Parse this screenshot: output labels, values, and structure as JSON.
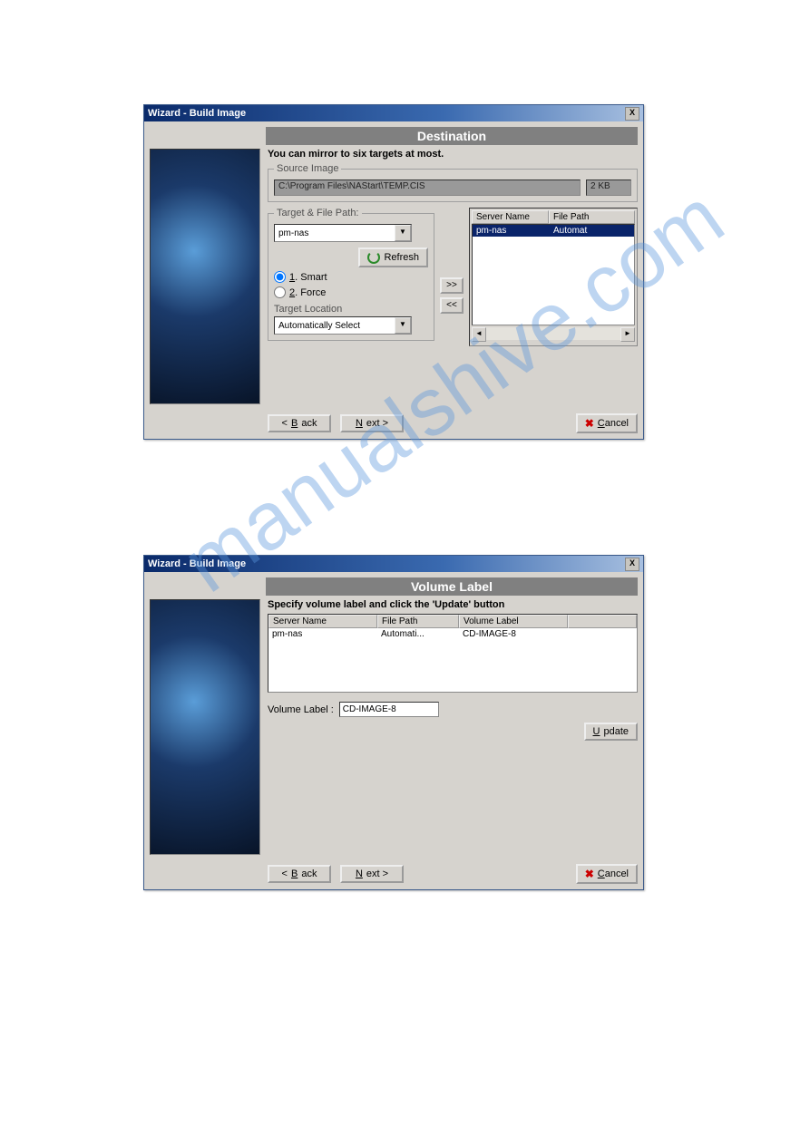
{
  "watermark": "manualshive.com",
  "window1": {
    "title": "Wizard - Build Image",
    "banner": "Destination",
    "subtitle": "You can mirror to six targets at most.",
    "source_legend": "Source Image",
    "source_path": "C:\\Program Files\\NAStart\\TEMP.CIS",
    "source_size": "2 KB",
    "target_legend": "Target & File Path:",
    "target_combo": "pm-nas",
    "refresh_btn": "Refresh",
    "radio_smart": "1. Smart",
    "radio_force": "2. Force",
    "loc_label": "Target Location",
    "loc_combo": "Automatically Select",
    "list_hdr_server": "Server Name",
    "list_hdr_path": "File Path",
    "list_row_server": "pm-nas",
    "list_row_path": "Automat",
    "btn_back": "< Back",
    "btn_next": "Next >",
    "btn_cancel": "Cancel"
  },
  "window2": {
    "title": "Wizard - Build Image",
    "banner": "Volume Label",
    "subtitle": "Specify volume label and click the 'Update' button",
    "hdr_server": "Server Name",
    "hdr_path": "File Path",
    "hdr_label": "Volume Label",
    "row_server": "pm-nas",
    "row_path": "Automati...",
    "row_label": "CD-IMAGE-8",
    "vol_caption": "Volume Label :",
    "vol_input": "CD-IMAGE-8",
    "btn_update": "Update",
    "btn_back": "< Back",
    "btn_next": "Next >",
    "btn_cancel": "Cancel"
  }
}
